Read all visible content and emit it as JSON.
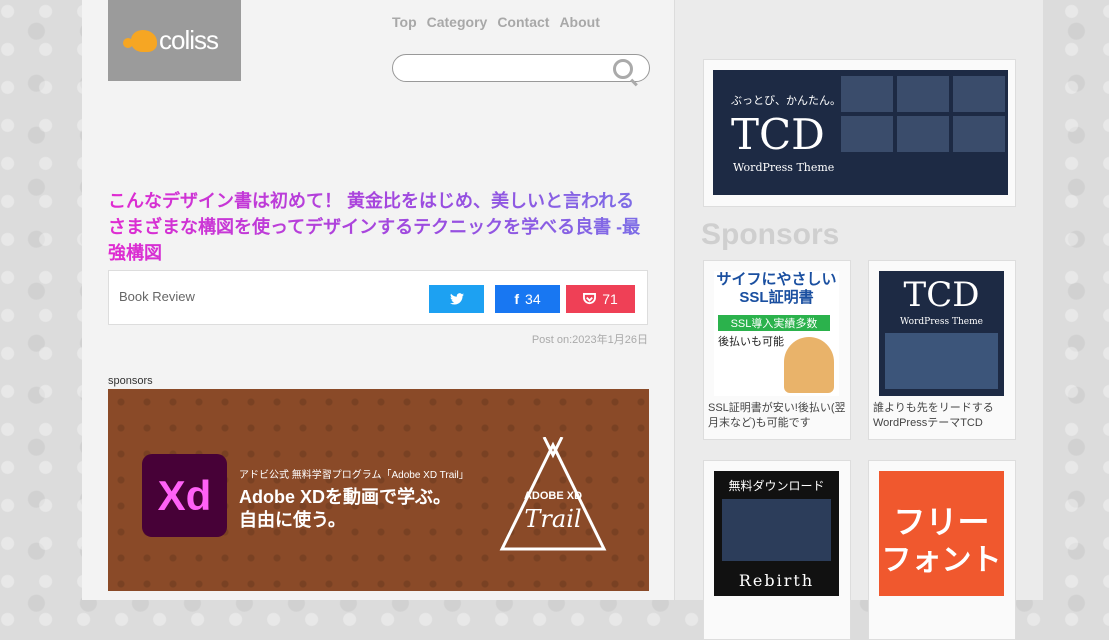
{
  "logo": {
    "text": "coliss"
  },
  "nav": {
    "items": [
      "Top",
      "Category",
      "Contact",
      "About"
    ]
  },
  "search": {
    "placeholder": ""
  },
  "article": {
    "title": "こんなデザイン書は初めて！ 黄金比をはじめ、美しいと言われるさまざまな構図を使ってデザインするテクニックを学べる良書 -最強構図",
    "category": "Book Review",
    "facebook_count": "34",
    "pocket_count": "71",
    "post_date": "Post on:2023年1月26日"
  },
  "sponsor_banner": {
    "label": "sponsors",
    "logo": "Xd",
    "small": "アドビ公式 無料学習プログラム「Adobe XD Trail」",
    "line1": "Adobe XDを動画で学ぶ。",
    "line2": "自由に使う。",
    "trail1": "ADOBE XD",
    "trail2": "Trail"
  },
  "sidebar": {
    "top_ad": {
      "tagline": "ぶっとび、かんたん。",
      "brand": "TCD",
      "sub": "WordPress Theme"
    },
    "heading": "Sponsors",
    "ads": [
      {
        "img_title": "サイフにやさしい SSL証明書",
        "img_badge": "SSL導入実績多数",
        "img_note": "後払いも可能",
        "caption": "SSL証明書が安い!後払い(翌月末など)も可能です",
        "color": "#1a4fa0"
      },
      {
        "img_title": "TCD",
        "img_note": "WordPress Theme",
        "caption": "誰よりも先をリードするWordPressテーマTCD",
        "color": "#1d2a44"
      },
      {
        "img_title": "無料ダウンロード",
        "img_note": "Rebirth",
        "caption": "",
        "color": "#111111"
      },
      {
        "img_title": "フリー",
        "img_note": "フォント",
        "caption": "",
        "color": "#f0582e"
      }
    ]
  }
}
